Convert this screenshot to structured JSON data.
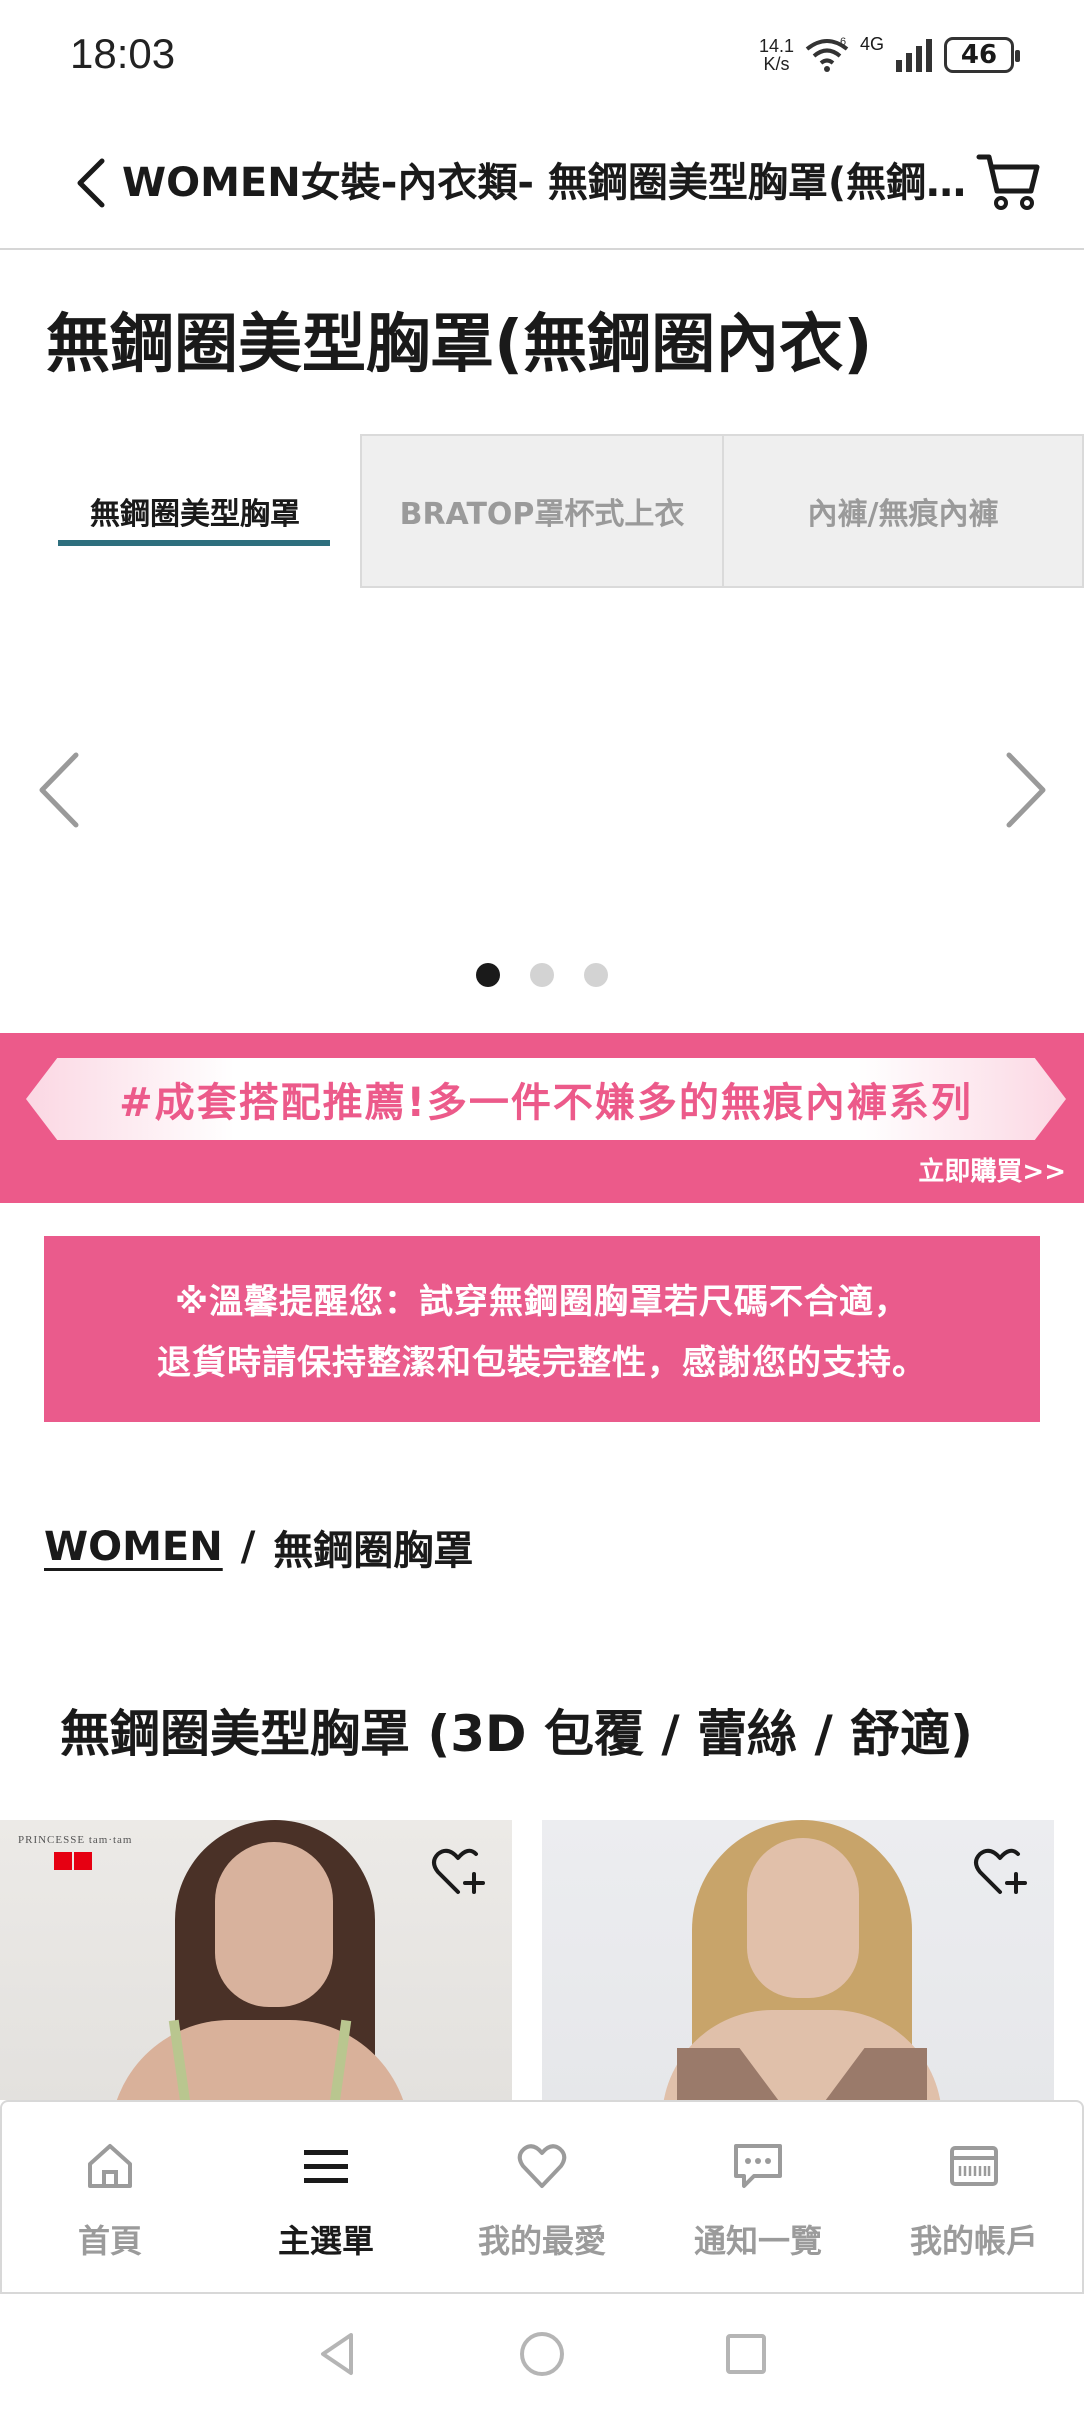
{
  "status_bar": {
    "time": "18:03",
    "net_speed_value": "14.1",
    "net_speed_unit": "K/s",
    "network": "4G",
    "battery": "46",
    "icons": [
      "wifi-icon",
      "signal-icon",
      "battery-icon"
    ]
  },
  "header": {
    "title": "WOMEN女裝-內衣類- 無鋼圈美型胸罩(無鋼…",
    "icons": [
      "back-icon",
      "cart-icon"
    ]
  },
  "page": {
    "title": "無鋼圈美型胸罩(無鋼圈內衣)"
  },
  "tabs": [
    {
      "label": "無鋼圈美型胸罩",
      "active": true
    },
    {
      "label": "BRATOP罩杯式上衣",
      "active": false
    },
    {
      "label": "內褲/無痕內褲",
      "active": false
    }
  ],
  "carousel": {
    "slide_count": 3,
    "active_index": 0,
    "icons": [
      "chevron-left-icon",
      "chevron-right-icon"
    ]
  },
  "promo": {
    "text": "#成套搭配推薦!多一件不嫌多的無痕內褲系列",
    "cta": "立即購買>>"
  },
  "notice": {
    "line1": "※溫馨提醒您：試穿無鋼圈胸罩若尺碼不合適，",
    "line2": "退貨時請保持整潔和包裝完整性，感謝您的支持。"
  },
  "breadcrumb": {
    "root": "WOMEN",
    "separator": "/",
    "current": "無鋼圈胸罩"
  },
  "section": {
    "heading": "無鋼圈美型胸罩 (3D 包覆 / 蕾絲 / 舒適)"
  },
  "products": [
    {
      "brand": "PRINCESSE tam·tam",
      "logo": "UNIQLO"
    },
    {
      "brand": "",
      "logo": ""
    }
  ],
  "bottom_nav": [
    {
      "label": "首頁",
      "icon": "home-icon",
      "active": false
    },
    {
      "label": "主選單",
      "icon": "menu-icon",
      "active": true
    },
    {
      "label": "我的最愛",
      "icon": "heart-icon",
      "active": false
    },
    {
      "label": "通知一覽",
      "icon": "chat-icon",
      "active": false
    },
    {
      "label": "我的帳戶",
      "icon": "account-card-icon",
      "active": false
    }
  ],
  "colors": {
    "accent_teal": "#2e6f7e",
    "promo_pink": "#ec5a8a",
    "notice_pink": "#ea5b8c",
    "uniqlo_red": "#e60012"
  }
}
